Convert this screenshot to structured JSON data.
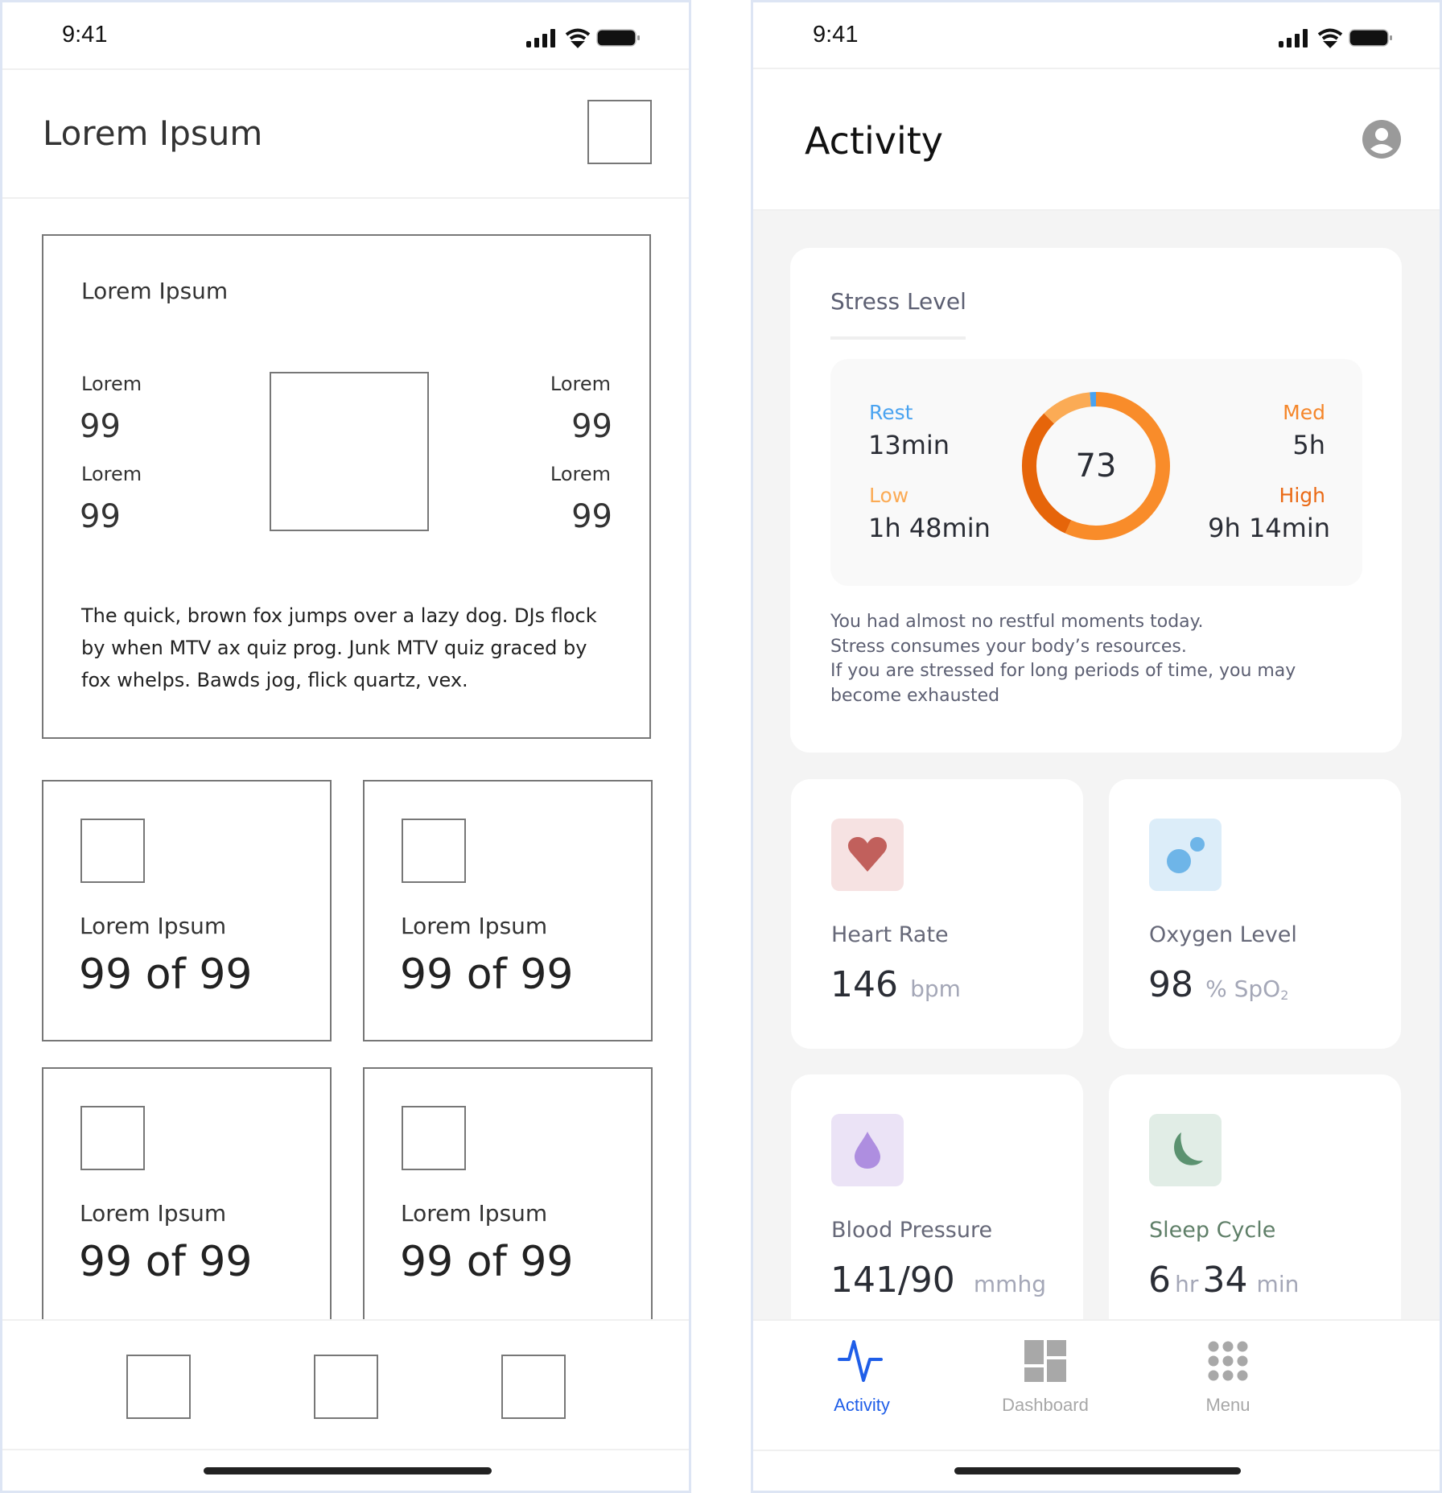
{
  "wireframe": {
    "status_time": "9:41",
    "header_title": "Lorem Ipsum",
    "summary_card": {
      "title": "Lorem Ipsum",
      "stats": [
        {
          "label": "Lorem",
          "value": "99"
        },
        {
          "label": "Lorem",
          "value": "99"
        },
        {
          "label": "Lorem",
          "value": "99"
        },
        {
          "label": "Lorem",
          "value": "99"
        }
      ],
      "paragraph_lines": [
        "The quick, brown fox jumps over a lazy dog. DJs flock",
        "by when MTV ax quiz prog. Junk MTV quiz graced by",
        "fox whelps. Bawds jog, flick quartz, vex."
      ]
    },
    "tiles": [
      {
        "label": "Lorem Ipsum",
        "value": "99 of 99"
      },
      {
        "label": "Lorem Ipsum",
        "value": "99 of 99"
      },
      {
        "label": "Lorem Ipsum",
        "value": "99 of 99"
      },
      {
        "label": "Lorem Ipsum",
        "value": "99 of 99"
      }
    ]
  },
  "app": {
    "status_time": "9:41",
    "header_title": "Activity",
    "stress": {
      "title": "Stress Level",
      "score": "73",
      "segments": [
        {
          "name": "Rest",
          "value": "13min",
          "minutes": 13,
          "label_color": "#4aa3f0",
          "ring_color": "#4aa3f0"
        },
        {
          "name": "Low",
          "value": "1h 48min",
          "minutes": 108,
          "label_color": "#fbab55",
          "ring_color": "#fbab55"
        },
        {
          "name": "Med",
          "value": "5h",
          "minutes": 300,
          "label_color": "#f5862a",
          "ring_color": "#e6650a"
        },
        {
          "name": "High",
          "value": "9h 14min",
          "minutes": 554,
          "label_color": "#ea6a16",
          "ring_color": "#f98c2a"
        }
      ],
      "description_lines": [
        "You had almost no restful moments today.",
        "Stress consumes your body’s resources.",
        "If you are stressed for long periods of time, you may",
        "become exhausted"
      ]
    },
    "metrics": [
      {
        "title": "Heart Rate",
        "value": "146",
        "unit": "bpm",
        "icon": "heart-icon",
        "tile_color": "#f6e2e2",
        "icon_color": "#c1605c",
        "title_color": "#666878"
      },
      {
        "title": "Oxygen Level",
        "value": "98",
        "unit": "% SpO",
        "unit_sub": "2",
        "icon": "oxygen-bubbles-icon",
        "tile_color": "#dcedf9",
        "icon_color": "#6eb5e8",
        "title_color": "#666878"
      },
      {
        "title": "Blood Pressure",
        "value": "141/90",
        "unit": "mmhg",
        "icon": "blood-drop-icon",
        "tile_color": "#ebe3f6",
        "icon_color": "#ae8ee0",
        "title_color": "#666878"
      },
      {
        "title": "Sleep Cycle",
        "value": "6",
        "unit": "hr",
        "value2": "34",
        "unit2": "min",
        "icon": "moon-icon",
        "tile_color": "#e1ede6",
        "icon_color": "#5b9270",
        "title_color": "#5f7f68"
      }
    ],
    "tabs": [
      {
        "label": "Activity",
        "icon": "activity-pulse-icon",
        "active": true
      },
      {
        "label": "Dashboard",
        "icon": "dashboard-icon",
        "active": false
      },
      {
        "label": "Menu",
        "icon": "menu-grid-icon",
        "active": false
      }
    ],
    "colors": {
      "accent": "#1f5ee8",
      "inactive": "#a8a8a8",
      "content_bg": "#f4f4f4"
    }
  }
}
